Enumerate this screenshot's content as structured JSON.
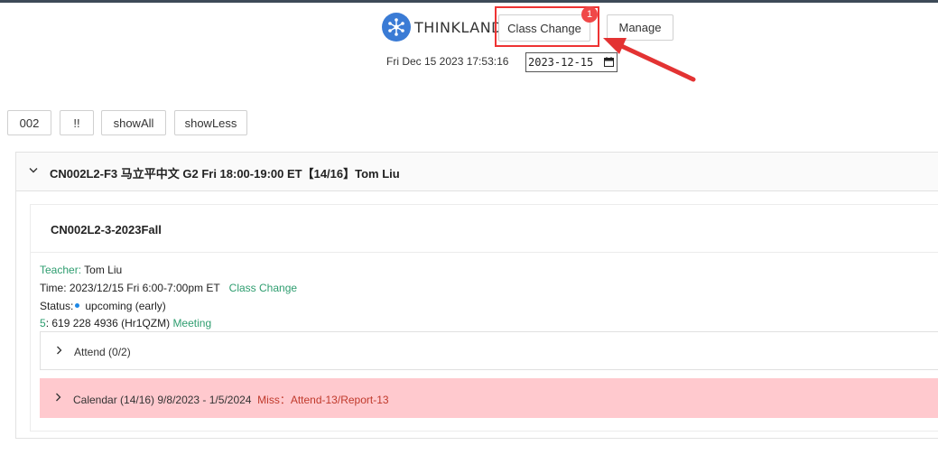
{
  "header": {
    "logo_text": "THINKLAND.AI",
    "class_change_label": "Class Change",
    "class_change_badge": "1",
    "manage_label": "Manage",
    "datetime": "Fri Dec 15 2023 17:53:16",
    "date_value": "2023-12-15"
  },
  "toolbar": {
    "btn_002": "002",
    "btn_exclaim": "!!",
    "btn_show_all": "showAll",
    "btn_show_less": "showLess"
  },
  "panel": {
    "title": "CN002L2-F3 马立平中文 G2 Fri 18:00-19:00 ET【14/16】Tom Liu",
    "card": {
      "title": "CN002L2-3-2023Fall",
      "teacher_label": "Teacher:",
      "teacher_name": "Tom Liu",
      "time_text": "Time: 2023/12/15 Fri 6:00-7:00pm ET",
      "class_change_link": "Class Change",
      "status_label": "Status:",
      "status_value": "upcoming (early)",
      "meeting_prefix": "5",
      "meeting_id": ": 619 228 4936 (Hr1QZM)",
      "meeting_link": "Meeting",
      "attend_label": "Attend (0/2)",
      "calendar_label": "Calendar (14/16) 9/8/2023 - 1/5/2024",
      "calendar_miss": "Miss：Attend-13/Report-13"
    }
  },
  "colors": {
    "accent_green": "#2e9d6f",
    "highlight_red": "#e33333",
    "calendar_bg": "#ffc9ce",
    "status_dot": "#1e88e5"
  }
}
